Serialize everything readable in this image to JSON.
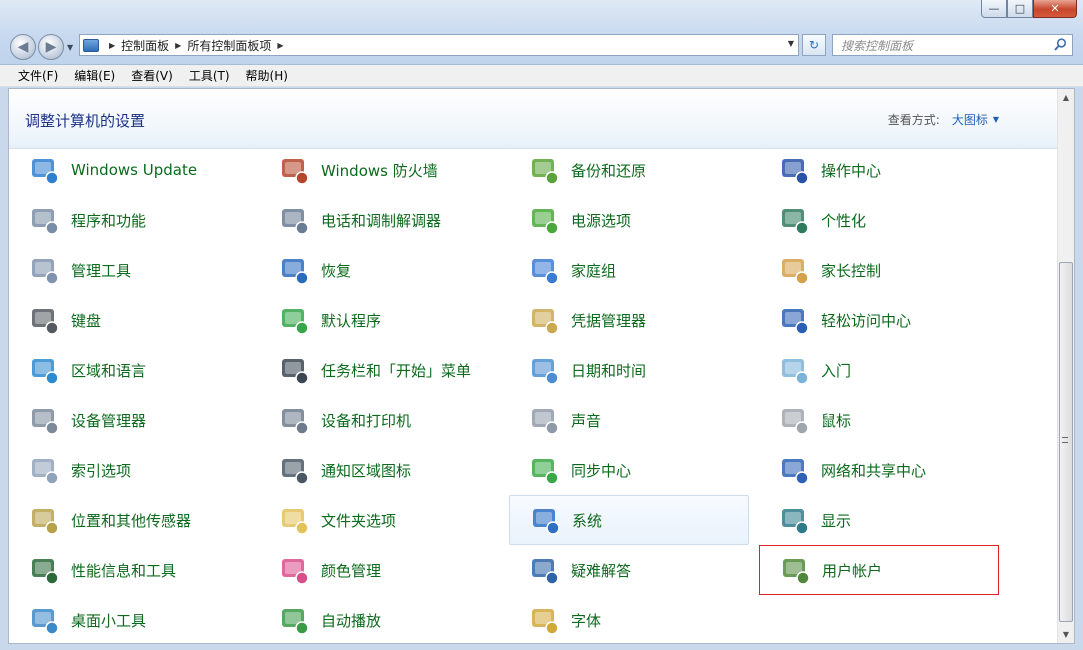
{
  "window": {
    "min": "—",
    "max": "□",
    "close": "✕"
  },
  "address": {
    "crumbs": [
      "控制面板",
      "所有控制面板项"
    ]
  },
  "search": {
    "placeholder": "搜索控制面板"
  },
  "menu": [
    "文件(F)",
    "编辑(E)",
    "查看(V)",
    "工具(T)",
    "帮助(H)"
  ],
  "header": {
    "title": "调整计算机的设置",
    "view_label": "查看方式:",
    "view_value": "大图标"
  },
  "items": [
    {
      "label": "Windows Update",
      "icon": "windows-update-icon",
      "color": "#2f7fd0"
    },
    {
      "label": "Windows 防火墙",
      "icon": "firewall-icon",
      "color": "#b5462b"
    },
    {
      "label": "备份和还原",
      "icon": "backup-icon",
      "color": "#5aa33a"
    },
    {
      "label": "操作中心",
      "icon": "action-center-flag-icon",
      "color": "#2853a9"
    },
    {
      "label": "程序和功能",
      "icon": "programs-icon",
      "color": "#7a8da6"
    },
    {
      "label": "电话和调制解调器",
      "icon": "phone-modem-icon",
      "color": "#6a7c93"
    },
    {
      "label": "电源选项",
      "icon": "power-options-icon",
      "color": "#4aa83b"
    },
    {
      "label": "个性化",
      "icon": "personalization-icon",
      "color": "#2f7b5d"
    },
    {
      "label": "管理工具",
      "icon": "admin-tools-icon",
      "color": "#7f93ae"
    },
    {
      "label": "恢复",
      "icon": "recovery-icon",
      "color": "#2a6bbd"
    },
    {
      "label": "家庭组",
      "icon": "homegroup-icon",
      "color": "#3a7bd5"
    },
    {
      "label": "家长控制",
      "icon": "parental-controls-icon",
      "color": "#d4a14a"
    },
    {
      "label": "键盘",
      "icon": "keyboard-icon",
      "color": "#555a62"
    },
    {
      "label": "默认程序",
      "icon": "default-programs-icon",
      "color": "#35a64a"
    },
    {
      "label": "凭据管理器",
      "icon": "credential-manager-icon",
      "color": "#c9a84f"
    },
    {
      "label": "轻松访问中心",
      "icon": "ease-of-access-icon",
      "color": "#2a5fb3"
    },
    {
      "label": "区域和语言",
      "icon": "region-language-icon",
      "color": "#2d8bd0"
    },
    {
      "label": "任务栏和「开始」菜单",
      "icon": "taskbar-start-icon",
      "color": "#3b4652"
    },
    {
      "label": "日期和时间",
      "icon": "date-time-icon",
      "color": "#4c8ed1"
    },
    {
      "label": "入门",
      "icon": "getting-started-icon",
      "color": "#7cb3d9"
    },
    {
      "label": "设备管理器",
      "icon": "device-manager-icon",
      "color": "#7d8a9a"
    },
    {
      "label": "设备和打印机",
      "icon": "devices-printers-icon",
      "color": "#6d7b8c"
    },
    {
      "label": "声音",
      "icon": "sound-icon",
      "color": "#8f9aa8"
    },
    {
      "label": "鼠标",
      "icon": "mouse-icon",
      "color": "#a0a6ad"
    },
    {
      "label": "索引选项",
      "icon": "indexing-icon",
      "color": "#8fa3ba"
    },
    {
      "label": "通知区域图标",
      "icon": "notification-icons-icon",
      "color": "#4a5866"
    },
    {
      "label": "同步中心",
      "icon": "sync-center-icon",
      "color": "#3aa846"
    },
    {
      "label": "网络和共享中心",
      "icon": "network-sharing-icon",
      "color": "#2d62b6"
    },
    {
      "label": "位置和其他传感器",
      "icon": "location-sensors-icon",
      "color": "#b8a14b"
    },
    {
      "label": "文件夹选项",
      "icon": "folder-options-icon",
      "color": "#e3c25a"
    },
    {
      "label": "系统",
      "icon": "system-icon",
      "color": "#2f6fc4"
    },
    {
      "label": "显示",
      "icon": "display-icon",
      "color": "#2f7b8c"
    },
    {
      "label": "性能信息和工具",
      "icon": "performance-icon",
      "color": "#2c6a3a"
    },
    {
      "label": "颜色管理",
      "icon": "color-management-icon",
      "color": "#d94f8a"
    },
    {
      "label": "疑难解答",
      "icon": "troubleshooting-icon",
      "color": "#2f63a8"
    },
    {
      "label": "用户帐户",
      "icon": "user-accounts-icon",
      "color": "#4f8a3a"
    },
    {
      "label": "桌面小工具",
      "icon": "desktop-gadgets-icon",
      "color": "#3c89c9"
    },
    {
      "label": "自动播放",
      "icon": "autoplay-icon",
      "color": "#3a9a46"
    },
    {
      "label": "字体",
      "icon": "fonts-icon",
      "color": "#d1a83c"
    }
  ]
}
